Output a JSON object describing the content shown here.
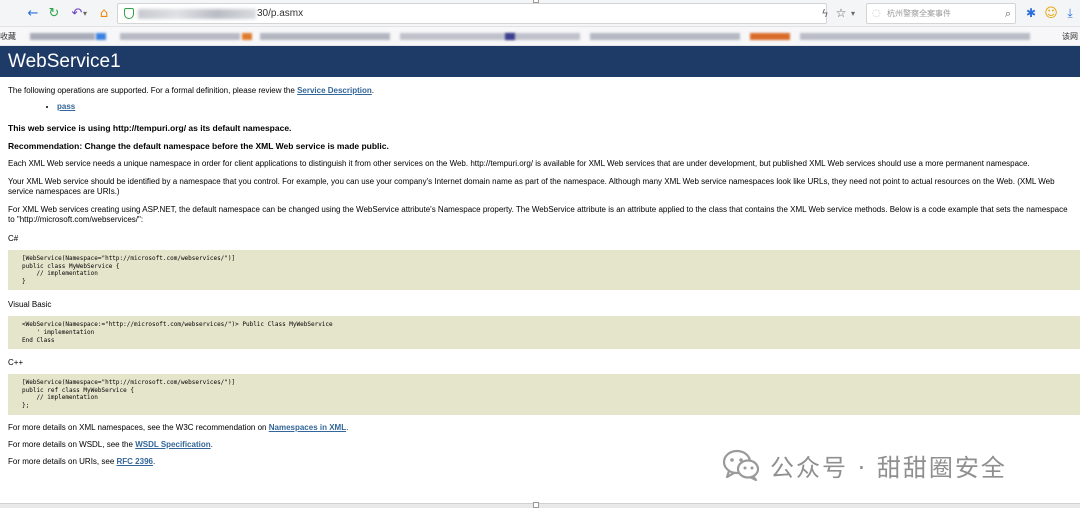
{
  "browser": {
    "url_visible_suffix": "30/p.asmx",
    "search_placeholder": "杭州警察全案事件",
    "bookmarks_left_label": "收藏",
    "bookmarks_right_label": "该网"
  },
  "page": {
    "title": "WebService1",
    "intro_text": "The following operations are supported. For a formal definition, please review the",
    "service_description_link": "Service Description",
    "intro_end": ".",
    "operations": [
      "pass"
    ],
    "namespace_notice": "This web service is using http://tempuri.org/ as its default namespace.",
    "recommendation": "Recommendation: Change the default namespace before the XML Web service is made public.",
    "para1": "Each XML Web service needs a unique namespace in order for client applications to distinguish it from other services on the Web. http://tempuri.org/ is available for XML Web services that are under development, but published XML Web services should use a more permanent namespace.",
    "para2": "Your XML Web service should be identified by a namespace that you control. For example, you can use your company's Internet domain name as part of the namespace. Although many XML Web service namespaces look like URLs, they need not point to actual resources on the Web. (XML Web service namespaces are URIs.)",
    "para3": "For XML Web services creating using ASP.NET, the default namespace can be changed using the WebService attribute's Namespace property. The WebService attribute is an attribute applied to the class that contains the XML Web service methods. Below is a code example that sets the namespace to \"http://microsoft.com/webservices/\":",
    "lang_csharp": "C#",
    "code_csharp": "[WebService(Namespace=\"http://microsoft.com/webservices/\")]\npublic class MyWebService {\n    // implementation\n}",
    "lang_vb": "Visual Basic",
    "code_vb": "<WebService(Namespace:=\"http://microsoft.com/webservices/\")> Public Class MyWebService\n    ' implementation\nEnd Class",
    "lang_cpp": "C++",
    "code_cpp": "[WebService(Namespace=\"http://microsoft.com/webservices/\")]\npublic ref class MyWebService {\n    // implementation\n};",
    "more_xml_prefix": "For more details on XML namespaces, see the W3C recommendation on",
    "more_xml_link": "Namespaces in XML",
    "more_wsdl_prefix": "For more details on WSDL, see the",
    "more_wsdl_link": "WSDL Specification",
    "more_uri_prefix": "For more details on URIs, see",
    "more_uri_link": "RFC 2396",
    "period": "."
  },
  "watermark": {
    "text": "公众号 · 甜甜圈安全"
  },
  "colors": {
    "heading_bg": "#1e3a66",
    "link": "#336699",
    "code_bg": "#e5e5cc"
  }
}
